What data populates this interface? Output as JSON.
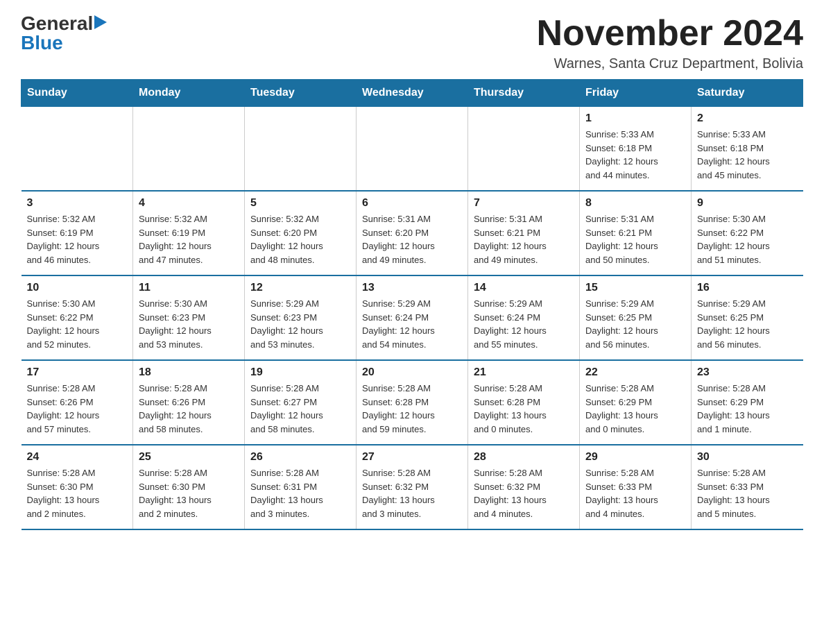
{
  "logo": {
    "general": "General",
    "blue": "Blue",
    "triangle": "▶"
  },
  "header": {
    "month_title": "November 2024",
    "location": "Warnes, Santa Cruz Department, Bolivia"
  },
  "weekdays": [
    "Sunday",
    "Monday",
    "Tuesday",
    "Wednesday",
    "Thursday",
    "Friday",
    "Saturday"
  ],
  "weeks": [
    [
      {
        "day": "",
        "info": ""
      },
      {
        "day": "",
        "info": ""
      },
      {
        "day": "",
        "info": ""
      },
      {
        "day": "",
        "info": ""
      },
      {
        "day": "",
        "info": ""
      },
      {
        "day": "1",
        "info": "Sunrise: 5:33 AM\nSunset: 6:18 PM\nDaylight: 12 hours\nand 44 minutes."
      },
      {
        "day": "2",
        "info": "Sunrise: 5:33 AM\nSunset: 6:18 PM\nDaylight: 12 hours\nand 45 minutes."
      }
    ],
    [
      {
        "day": "3",
        "info": "Sunrise: 5:32 AM\nSunset: 6:19 PM\nDaylight: 12 hours\nand 46 minutes."
      },
      {
        "day": "4",
        "info": "Sunrise: 5:32 AM\nSunset: 6:19 PM\nDaylight: 12 hours\nand 47 minutes."
      },
      {
        "day": "5",
        "info": "Sunrise: 5:32 AM\nSunset: 6:20 PM\nDaylight: 12 hours\nand 48 minutes."
      },
      {
        "day": "6",
        "info": "Sunrise: 5:31 AM\nSunset: 6:20 PM\nDaylight: 12 hours\nand 49 minutes."
      },
      {
        "day": "7",
        "info": "Sunrise: 5:31 AM\nSunset: 6:21 PM\nDaylight: 12 hours\nand 49 minutes."
      },
      {
        "day": "8",
        "info": "Sunrise: 5:31 AM\nSunset: 6:21 PM\nDaylight: 12 hours\nand 50 minutes."
      },
      {
        "day": "9",
        "info": "Sunrise: 5:30 AM\nSunset: 6:22 PM\nDaylight: 12 hours\nand 51 minutes."
      }
    ],
    [
      {
        "day": "10",
        "info": "Sunrise: 5:30 AM\nSunset: 6:22 PM\nDaylight: 12 hours\nand 52 minutes."
      },
      {
        "day": "11",
        "info": "Sunrise: 5:30 AM\nSunset: 6:23 PM\nDaylight: 12 hours\nand 53 minutes."
      },
      {
        "day": "12",
        "info": "Sunrise: 5:29 AM\nSunset: 6:23 PM\nDaylight: 12 hours\nand 53 minutes."
      },
      {
        "day": "13",
        "info": "Sunrise: 5:29 AM\nSunset: 6:24 PM\nDaylight: 12 hours\nand 54 minutes."
      },
      {
        "day": "14",
        "info": "Sunrise: 5:29 AM\nSunset: 6:24 PM\nDaylight: 12 hours\nand 55 minutes."
      },
      {
        "day": "15",
        "info": "Sunrise: 5:29 AM\nSunset: 6:25 PM\nDaylight: 12 hours\nand 56 minutes."
      },
      {
        "day": "16",
        "info": "Sunrise: 5:29 AM\nSunset: 6:25 PM\nDaylight: 12 hours\nand 56 minutes."
      }
    ],
    [
      {
        "day": "17",
        "info": "Sunrise: 5:28 AM\nSunset: 6:26 PM\nDaylight: 12 hours\nand 57 minutes."
      },
      {
        "day": "18",
        "info": "Sunrise: 5:28 AM\nSunset: 6:26 PM\nDaylight: 12 hours\nand 58 minutes."
      },
      {
        "day": "19",
        "info": "Sunrise: 5:28 AM\nSunset: 6:27 PM\nDaylight: 12 hours\nand 58 minutes."
      },
      {
        "day": "20",
        "info": "Sunrise: 5:28 AM\nSunset: 6:28 PM\nDaylight: 12 hours\nand 59 minutes."
      },
      {
        "day": "21",
        "info": "Sunrise: 5:28 AM\nSunset: 6:28 PM\nDaylight: 13 hours\nand 0 minutes."
      },
      {
        "day": "22",
        "info": "Sunrise: 5:28 AM\nSunset: 6:29 PM\nDaylight: 13 hours\nand 0 minutes."
      },
      {
        "day": "23",
        "info": "Sunrise: 5:28 AM\nSunset: 6:29 PM\nDaylight: 13 hours\nand 1 minute."
      }
    ],
    [
      {
        "day": "24",
        "info": "Sunrise: 5:28 AM\nSunset: 6:30 PM\nDaylight: 13 hours\nand 2 minutes."
      },
      {
        "day": "25",
        "info": "Sunrise: 5:28 AM\nSunset: 6:30 PM\nDaylight: 13 hours\nand 2 minutes."
      },
      {
        "day": "26",
        "info": "Sunrise: 5:28 AM\nSunset: 6:31 PM\nDaylight: 13 hours\nand 3 minutes."
      },
      {
        "day": "27",
        "info": "Sunrise: 5:28 AM\nSunset: 6:32 PM\nDaylight: 13 hours\nand 3 minutes."
      },
      {
        "day": "28",
        "info": "Sunrise: 5:28 AM\nSunset: 6:32 PM\nDaylight: 13 hours\nand 4 minutes."
      },
      {
        "day": "29",
        "info": "Sunrise: 5:28 AM\nSunset: 6:33 PM\nDaylight: 13 hours\nand 4 minutes."
      },
      {
        "day": "30",
        "info": "Sunrise: 5:28 AM\nSunset: 6:33 PM\nDaylight: 13 hours\nand 5 minutes."
      }
    ]
  ]
}
